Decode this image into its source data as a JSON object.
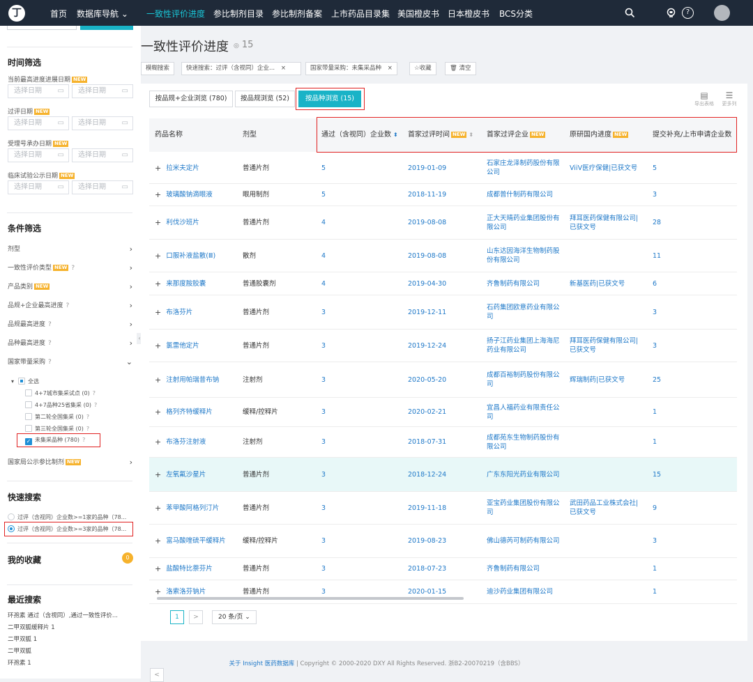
{
  "topbar": {
    "logo_glyph": "丁",
    "nav": [
      {
        "label": "首页"
      },
      {
        "label": "数据库导航 ⌄"
      },
      {
        "label": "一致性评价进度",
        "active": true
      },
      {
        "label": "参比制剂目录"
      },
      {
        "label": "参比制剂备案"
      },
      {
        "label": "上市药品目录集"
      },
      {
        "label": "美国橙皮书"
      },
      {
        "label": "日本橙皮书"
      },
      {
        "label": "BCS分类"
      }
    ],
    "icons": [
      "search-icon",
      "notification-icon",
      "help-icon",
      "avatar"
    ],
    "accent_color": "#19c6d7",
    "bg_color": "#1f2a39"
  },
  "sidebar": {
    "time_filter": {
      "title": "时间筛选",
      "new_badge": "NEW",
      "groups": [
        {
          "label": "当前最高进度进展日期"
        },
        {
          "label": "过评日期"
        },
        {
          "label": "受理号承办日期"
        },
        {
          "label": "临床试验公示日期"
        }
      ],
      "placeholder": "选择日期"
    },
    "condition_filter": {
      "title": "条件筛选",
      "items": [
        {
          "label": "剂型"
        },
        {
          "label": "一致性评价类型",
          "help": "?"
        },
        {
          "label": "产品类别"
        },
        {
          "label": "品规+企业最高进度",
          "help": "?"
        },
        {
          "label": "品规最高进度",
          "help": "?"
        },
        {
          "label": "品种最高进度",
          "help": "?"
        },
        {
          "label": "国家带量采购",
          "help": "?"
        }
      ],
      "procurement_options": [
        {
          "label": "全选"
        },
        {
          "label": "4+7城市集采试点 (0)"
        },
        {
          "label": "4+7品种25省集采 (0)"
        },
        {
          "label": "第二轮全国集采 (0)"
        },
        {
          "label": "第三轮全国集采 (0)"
        },
        {
          "label": "未集采品种 (780)"
        }
      ],
      "last_item": {
        "label": "国家局公示参比制剂"
      },
      "help_glyph": "?",
      "arrow_right": "›",
      "arrow_down": "⌄",
      "tree_toggle": "▾"
    },
    "quick_search": {
      "title": "快速搜索",
      "options": [
        {
          "label": "过评（含视同）企业数>=1家的品种（78..."
        },
        {
          "label": "过评（含视同）企业数>=3家的品种（78..."
        }
      ]
    },
    "favorites": {
      "title": "我的收藏",
      "count": "0"
    },
    "recent": {
      "title": "最近搜索",
      "items": [
        "环孢素 通过（含视同）,通过一致性评价...",
        "二甲双胍缓释片 1",
        "二甲双胍 1",
        "二甲双胍",
        "环孢素 1"
      ]
    },
    "collapse_glyph": "‹"
  },
  "main": {
    "title": "一致性评价进度",
    "title_icon": "◎",
    "count": "15",
    "chips": [
      {
        "label": "模糊搜索"
      },
      {
        "label": "快速搜索：过评（含视同）企业...",
        "close": "×"
      },
      {
        "label": "国家带量采购：未集采品种",
        "close": "×"
      },
      {
        "label": "☆收藏"
      },
      {
        "label": "🗑 清空"
      }
    ],
    "tabs": [
      {
        "label": "按品规+企业浏览 (780)"
      },
      {
        "label": "按品规浏览 (52)"
      },
      {
        "label": "按品种浏览 (15)"
      }
    ],
    "tools": [
      {
        "glyph": "▤",
        "label": "导出表格"
      },
      {
        "glyph": "☰",
        "label": "更多列"
      }
    ],
    "table": {
      "headers": [
        "药品名称",
        "剂型",
        "通过（含视同）企业数",
        "首家过评时间",
        "首家过评企业",
        "原研国内进度",
        "提交补充/上市申请企业数"
      ],
      "sort_glyph": "⬍",
      "plus_glyph": "+",
      "rows": [
        {
          "name": "拉米夫定片",
          "form": "普通片剂",
          "passed": "5",
          "first_date": "2019-01-09",
          "first_company": "石家庄龙泽制药股份有限公司",
          "orig": "ViiV医疗保健|已获文号",
          "applicants": "5"
        },
        {
          "name": "玻璃酸钠滴眼液",
          "form": "眼用制剂",
          "passed": "5",
          "first_date": "2018-11-19",
          "first_company": "成都普什制药有限公司",
          "orig": "",
          "applicants": "3"
        },
        {
          "name": "利伐沙班片",
          "form": "普通片剂",
          "passed": "4",
          "first_date": "2019-08-08",
          "first_company": "正大天晴药业集团股份有限公司",
          "orig": "拜耳医药保健有限公司|已获文号",
          "applicants": "28"
        },
        {
          "name": "口服补液盐散(Ⅲ)",
          "form": "散剂",
          "passed": "4",
          "first_date": "2019-08-08",
          "first_company": "山东达因海洋生物制药股份有限公司",
          "orig": "",
          "applicants": "11"
        },
        {
          "name": "来那度胺胶囊",
          "form": "普通胶囊剂",
          "passed": "4",
          "first_date": "2019-04-30",
          "first_company": "齐鲁制药有限公司",
          "orig": "新基医药|已获文号",
          "applicants": "6"
        },
        {
          "name": "布洛芬片",
          "form": "普通片剂",
          "passed": "3",
          "first_date": "2019-12-11",
          "first_company": "石药集团欧意药业有限公司",
          "orig": "",
          "applicants": "3"
        },
        {
          "name": "氯雷他定片",
          "form": "普通片剂",
          "passed": "3",
          "first_date": "2019-12-24",
          "first_company": "扬子江药业集团上海海尼药业有限公司",
          "orig": "拜耳医药保健有限公司|已获文号",
          "applicants": "3"
        },
        {
          "name": "注射用帕瑞昔布钠",
          "form": "注射剂",
          "passed": "3",
          "first_date": "2020-05-20",
          "first_company": "成都百裕制药股份有限公司",
          "orig": "辉瑞制药|已获文号",
          "applicants": "25"
        },
        {
          "name": "格列齐特缓释片",
          "form": "缓释/控释片",
          "passed": "3",
          "first_date": "2020-02-21",
          "first_company": "宜昌人福药业有限责任公司",
          "orig": "",
          "applicants": "1"
        },
        {
          "name": "布洛芬注射液",
          "form": "注射剂",
          "passed": "3",
          "first_date": "2018-07-31",
          "first_company": "成都苑东生物制药股份有限公司",
          "orig": "",
          "applicants": "1"
        },
        {
          "name": "左氧氟沙星片",
          "form": "普通片剂",
          "passed": "3",
          "first_date": "2018-12-24",
          "first_company": "广东东阳光药业有限公司",
          "orig": "",
          "applicants": "15",
          "highlight": true
        },
        {
          "name": "苯甲酸阿格列汀片",
          "form": "普通片剂",
          "passed": "3",
          "first_date": "2019-11-18",
          "first_company": "亚宝药业集团股份有限公司",
          "orig": "武田药品工业株式会社|已获文号",
          "applicants": "9"
        },
        {
          "name": "富马酸喹硫平缓释片",
          "form": "缓释/控释片",
          "passed": "3",
          "first_date": "2019-08-23",
          "first_company": "佛山德芮可制药有限公司",
          "orig": "",
          "applicants": "3"
        },
        {
          "name": "盐酸特比萘芬片",
          "form": "普通片剂",
          "passed": "3",
          "first_date": "2018-07-23",
          "first_company": "齐鲁制药有限公司",
          "orig": "",
          "applicants": "1"
        },
        {
          "name": "洛索洛芬钠片",
          "form": "普通片剂",
          "passed": "3",
          "first_date": "2020-01-15",
          "first_company": "迪沙药业集团有限公司",
          "orig": "",
          "applicants": "1"
        }
      ]
    },
    "pagination": {
      "prev": "<",
      "page": "1",
      "next": ">",
      "size": "20 条/页 ⌄"
    }
  },
  "footer": {
    "link": "关于 Insight 医药数据库",
    "copyright": "|  Copyright © 2000-2020 DXY All Rights Reserved. 浙B2-20070219（含BBS）"
  }
}
